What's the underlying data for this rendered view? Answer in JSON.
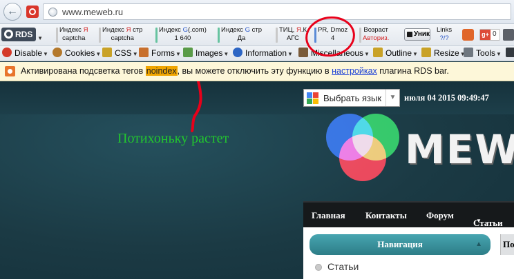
{
  "address_bar": {
    "url": "www.meweb.ru"
  },
  "rds_bar": {
    "logo_label": "RDS",
    "metrics": [
      {
        "line1_a": "Индекс ",
        "line1_b": "Я",
        "line1_b_color": "red",
        "line1_c": "",
        "line2": "captcha",
        "bar_color": "#c9c9c9"
      },
      {
        "line1_a": "Индекс ",
        "line1_b": "Я",
        "line1_b_color": "red",
        "line1_c": " стр",
        "line2": "captcha",
        "bar_color": "#c9c9c9"
      },
      {
        "line1_a": "Индекс ",
        "line1_b": "G",
        "line1_b_color": "blue",
        "line1_c": "(.com)",
        "line2": "1 640",
        "bar_color": "#67c3a0"
      },
      {
        "line1_a": "Индекс ",
        "line1_b": "G",
        "line1_b_color": "blue",
        "line1_c": " стр",
        "line2": "Да",
        "bar_color": "#67c3a0"
      },
      {
        "line1_a": "ТИЦ, ",
        "line1_b": "Я",
        "line1_b_color": "red",
        "line1_c": ".К",
        "line2": "АГС",
        "bar_color": "#c9c9c9"
      },
      {
        "line1_a": "PR, Dmoz",
        "line1_b": "",
        "line1_b_color": "blue",
        "line1_c": "",
        "line2": "4",
        "bar_color": "#5b8bd6"
      },
      {
        "line1_a": "Возраст",
        "line1_b": "",
        "line1_b_color": "red",
        "line1_c": "",
        "line2": "Авториз.",
        "bar_color": "#c9c9c9"
      }
    ],
    "unik_label": "Уник",
    "links_line1": "Links",
    "links_line2": "?/?",
    "gplus_label": "g+",
    "gplus_count": "0"
  },
  "dev_toolbar": {
    "items": [
      {
        "label": "Disable",
        "icon_color": "#d43a2a",
        "icon": "disable-icon"
      },
      {
        "label": "Cookies",
        "icon_color": "#b4792c",
        "icon": "cookie-icon"
      },
      {
        "label": "CSS",
        "icon_color": "#c9a227",
        "icon": "wand-icon"
      },
      {
        "label": "Forms",
        "icon_color": "#c8702e",
        "icon": "form-icon"
      },
      {
        "label": "Images",
        "icon_color": "#5a9b48",
        "icon": "image-icon"
      },
      {
        "label": "Information",
        "icon_color": "#2c65c4",
        "icon": "info-icon"
      },
      {
        "label": "Miscellaneous",
        "icon_color": "#7a5b3a",
        "icon": "folder-icon"
      },
      {
        "label": "Outline",
        "icon_color": "#c9a227",
        "icon": "pencil-icon"
      },
      {
        "label": "Resize",
        "icon_color": "#c9a227",
        "icon": "resize-icon"
      },
      {
        "label": "Tools",
        "icon_color": "#6f7780",
        "icon": "tools-icon"
      }
    ]
  },
  "notification": {
    "text_before": "Активирована подсветка тегов ",
    "highlight": "noindex",
    "text_middle": ", вы можете отключить эту функцию в ",
    "link": "настройках",
    "text_after": " плагина RDS bar."
  },
  "site": {
    "translate_label": "Выбрать язык",
    "date_text": "июля 04 2015 09:49:47",
    "brand_text": "MEW",
    "annotation_text": "Потихоньку растет",
    "menu_items": [
      {
        "label": "Главная",
        "dropdown": false
      },
      {
        "label": "Контакты",
        "dropdown": false
      },
      {
        "label": "Форум",
        "dropdown": false
      },
      {
        "label": "Статьи",
        "dropdown": true
      }
    ],
    "nav_title": "Навигация",
    "right_tab_text": "По",
    "nav_items": [
      "Статьи"
    ]
  }
}
